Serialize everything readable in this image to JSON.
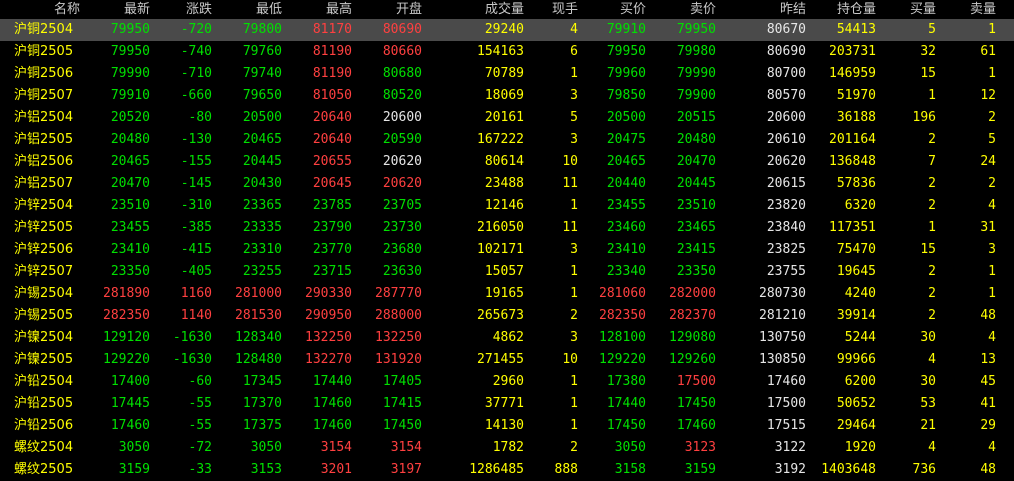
{
  "headers": [
    "名称",
    "最新",
    "涨跌",
    "最低",
    "最高",
    "开盘",
    "成交量",
    "现手",
    "买价",
    "卖价",
    "昨结",
    "持仓量",
    "买量",
    "卖量"
  ],
  "rows": [
    {
      "name": "沪铜2504",
      "last": "79950",
      "chg": "-720",
      "low": "79800",
      "high": "81170",
      "open": "80690",
      "vol": "29240",
      "cur": "4",
      "bid": "79910",
      "ask": "79950",
      "prev": "80670",
      "oi": "54413",
      "bv": "5",
      "av": "1",
      "colors": [
        "down",
        "down",
        "down",
        "up",
        "up"
      ],
      "bidc": "down",
      "askc": "down"
    },
    {
      "name": "沪铜2505",
      "last": "79950",
      "chg": "-740",
      "low": "79760",
      "high": "81190",
      "open": "80660",
      "vol": "154163",
      "cur": "6",
      "bid": "79950",
      "ask": "79980",
      "prev": "80690",
      "oi": "203731",
      "bv": "32",
      "av": "61",
      "colors": [
        "down",
        "down",
        "down",
        "up",
        "up"
      ],
      "bidc": "down",
      "askc": "down"
    },
    {
      "name": "沪铜2506",
      "last": "79990",
      "chg": "-710",
      "low": "79740",
      "high": "81190",
      "open": "80680",
      "vol": "70789",
      "cur": "1",
      "bid": "79960",
      "ask": "79990",
      "prev": "80700",
      "oi": "146959",
      "bv": "15",
      "av": "1",
      "colors": [
        "down",
        "down",
        "down",
        "up",
        "down"
      ],
      "bidc": "down",
      "askc": "down"
    },
    {
      "name": "沪铜2507",
      "last": "79910",
      "chg": "-660",
      "low": "79650",
      "high": "81050",
      "open": "80520",
      "vol": "18069",
      "cur": "3",
      "bid": "79850",
      "ask": "79900",
      "prev": "80570",
      "oi": "51970",
      "bv": "1",
      "av": "12",
      "colors": [
        "down",
        "down",
        "down",
        "up",
        "down"
      ],
      "bidc": "down",
      "askc": "down"
    },
    {
      "name": "沪铝2504",
      "last": "20520",
      "chg": "-80",
      "low": "20500",
      "high": "20640",
      "open": "20600",
      "vol": "20161",
      "cur": "5",
      "bid": "20500",
      "ask": "20515",
      "prev": "20600",
      "oi": "36188",
      "bv": "196",
      "av": "2",
      "colors": [
        "down",
        "down",
        "down",
        "up",
        "flat"
      ],
      "bidc": "down",
      "askc": "down"
    },
    {
      "name": "沪铝2505",
      "last": "20480",
      "chg": "-130",
      "low": "20465",
      "high": "20640",
      "open": "20590",
      "vol": "167222",
      "cur": "3",
      "bid": "20475",
      "ask": "20480",
      "prev": "20610",
      "oi": "201164",
      "bv": "2",
      "av": "5",
      "colors": [
        "down",
        "down",
        "down",
        "up",
        "down"
      ],
      "bidc": "down",
      "askc": "down"
    },
    {
      "name": "沪铝2506",
      "last": "20465",
      "chg": "-155",
      "low": "20445",
      "high": "20655",
      "open": "20620",
      "vol": "80614",
      "cur": "10",
      "bid": "20465",
      "ask": "20470",
      "prev": "20620",
      "oi": "136848",
      "bv": "7",
      "av": "24",
      "colors": [
        "down",
        "down",
        "down",
        "up",
        "flat"
      ],
      "bidc": "down",
      "askc": "down"
    },
    {
      "name": "沪铝2507",
      "last": "20470",
      "chg": "-145",
      "low": "20430",
      "high": "20645",
      "open": "20620",
      "vol": "23488",
      "cur": "11",
      "bid": "20440",
      "ask": "20445",
      "prev": "20615",
      "oi": "57836",
      "bv": "2",
      "av": "2",
      "colors": [
        "down",
        "down",
        "down",
        "up",
        "up"
      ],
      "bidc": "down",
      "askc": "down"
    },
    {
      "name": "沪锌2504",
      "last": "23510",
      "chg": "-310",
      "low": "23365",
      "high": "23785",
      "open": "23705",
      "vol": "12146",
      "cur": "1",
      "bid": "23455",
      "ask": "23510",
      "prev": "23820",
      "oi": "6320",
      "bv": "2",
      "av": "4",
      "colors": [
        "down",
        "down",
        "down",
        "down",
        "down"
      ],
      "bidc": "down",
      "askc": "down"
    },
    {
      "name": "沪锌2505",
      "last": "23455",
      "chg": "-385",
      "low": "23335",
      "high": "23790",
      "open": "23730",
      "vol": "216050",
      "cur": "11",
      "bid": "23460",
      "ask": "23465",
      "prev": "23840",
      "oi": "117351",
      "bv": "1",
      "av": "31",
      "colors": [
        "down",
        "down",
        "down",
        "down",
        "down"
      ],
      "bidc": "down",
      "askc": "down"
    },
    {
      "name": "沪锌2506",
      "last": "23410",
      "chg": "-415",
      "low": "23310",
      "high": "23770",
      "open": "23680",
      "vol": "102171",
      "cur": "3",
      "bid": "23410",
      "ask": "23415",
      "prev": "23825",
      "oi": "75470",
      "bv": "15",
      "av": "3",
      "colors": [
        "down",
        "down",
        "down",
        "down",
        "down"
      ],
      "bidc": "down",
      "askc": "down"
    },
    {
      "name": "沪锌2507",
      "last": "23350",
      "chg": "-405",
      "low": "23255",
      "high": "23715",
      "open": "23630",
      "vol": "15057",
      "cur": "1",
      "bid": "23340",
      "ask": "23350",
      "prev": "23755",
      "oi": "19645",
      "bv": "2",
      "av": "1",
      "colors": [
        "down",
        "down",
        "down",
        "down",
        "down"
      ],
      "bidc": "down",
      "askc": "down"
    },
    {
      "name": "沪锡2504",
      "last": "281890",
      "chg": "1160",
      "low": "281000",
      "high": "290330",
      "open": "287770",
      "vol": "19165",
      "cur": "1",
      "bid": "281060",
      "ask": "282000",
      "prev": "280730",
      "oi": "4240",
      "bv": "2",
      "av": "1",
      "colors": [
        "up",
        "up",
        "up",
        "up",
        "up"
      ],
      "bidc": "up",
      "askc": "up"
    },
    {
      "name": "沪锡2505",
      "last": "282350",
      "chg": "1140",
      "low": "281530",
      "high": "290950",
      "open": "288000",
      "vol": "265673",
      "cur": "2",
      "bid": "282350",
      "ask": "282370",
      "prev": "281210",
      "oi": "39914",
      "bv": "2",
      "av": "48",
      "colors": [
        "up",
        "up",
        "up",
        "up",
        "up"
      ],
      "bidc": "up",
      "askc": "up"
    },
    {
      "name": "沪镍2504",
      "last": "129120",
      "chg": "-1630",
      "low": "128340",
      "high": "132250",
      "open": "132250",
      "vol": "4862",
      "cur": "3",
      "bid": "128100",
      "ask": "129080",
      "prev": "130750",
      "oi": "5244",
      "bv": "30",
      "av": "4",
      "colors": [
        "down",
        "down",
        "down",
        "up",
        "up"
      ],
      "bidc": "down",
      "askc": "down"
    },
    {
      "name": "沪镍2505",
      "last": "129220",
      "chg": "-1630",
      "low": "128480",
      "high": "132270",
      "open": "131920",
      "vol": "271455",
      "cur": "10",
      "bid": "129220",
      "ask": "129260",
      "prev": "130850",
      "oi": "99966",
      "bv": "4",
      "av": "13",
      "colors": [
        "down",
        "down",
        "down",
        "up",
        "up"
      ],
      "bidc": "down",
      "askc": "down"
    },
    {
      "name": "沪铅2504",
      "last": "17400",
      "chg": "-60",
      "low": "17345",
      "high": "17440",
      "open": "17405",
      "vol": "2960",
      "cur": "1",
      "bid": "17380",
      "ask": "17500",
      "prev": "17460",
      "oi": "6200",
      "bv": "30",
      "av": "45",
      "colors": [
        "down",
        "down",
        "down",
        "down",
        "down"
      ],
      "bidc": "down",
      "askc": "up"
    },
    {
      "name": "沪铅2505",
      "last": "17445",
      "chg": "-55",
      "low": "17370",
      "high": "17460",
      "open": "17415",
      "vol": "37771",
      "cur": "1",
      "bid": "17440",
      "ask": "17450",
      "prev": "17500",
      "oi": "50652",
      "bv": "53",
      "av": "41",
      "colors": [
        "down",
        "down",
        "down",
        "down",
        "down"
      ],
      "bidc": "down",
      "askc": "down"
    },
    {
      "name": "沪铅2506",
      "last": "17460",
      "chg": "-55",
      "low": "17375",
      "high": "17460",
      "open": "17450",
      "vol": "14130",
      "cur": "1",
      "bid": "17450",
      "ask": "17460",
      "prev": "17515",
      "oi": "29464",
      "bv": "21",
      "av": "29",
      "colors": [
        "down",
        "down",
        "down",
        "down",
        "down"
      ],
      "bidc": "down",
      "askc": "down"
    },
    {
      "name": "螺纹2504",
      "last": "3050",
      "chg": "-72",
      "low": "3050",
      "high": "3154",
      "open": "3154",
      "vol": "1782",
      "cur": "2",
      "bid": "3050",
      "ask": "3123",
      "prev": "3122",
      "oi": "1920",
      "bv": "4",
      "av": "4",
      "colors": [
        "down",
        "down",
        "down",
        "up",
        "up"
      ],
      "bidc": "down",
      "askc": "up"
    },
    {
      "name": "螺纹2505",
      "last": "3159",
      "chg": "-33",
      "low": "3153",
      "high": "3201",
      "open": "3197",
      "vol": "1286485",
      "cur": "888",
      "bid": "3158",
      "ask": "3159",
      "prev": "3192",
      "oi": "1403648",
      "bv": "736",
      "av": "48",
      "colors": [
        "down",
        "down",
        "down",
        "up",
        "up"
      ],
      "bidc": "down",
      "askc": "down"
    }
  ]
}
